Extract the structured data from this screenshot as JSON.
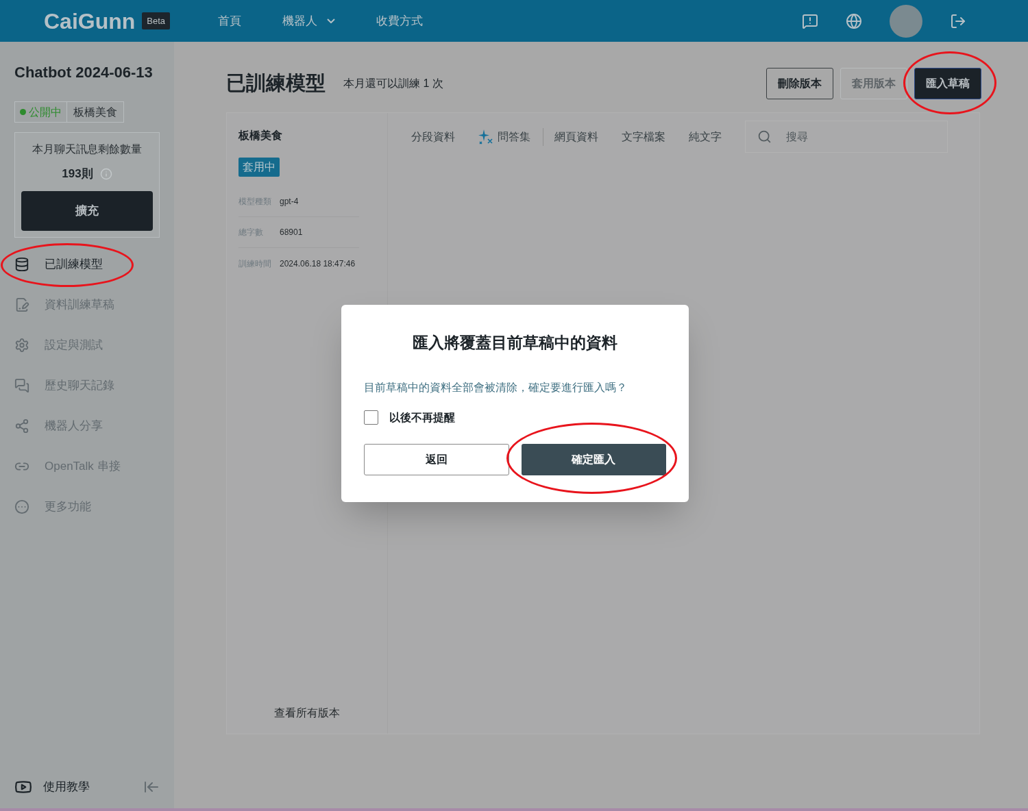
{
  "header": {
    "logo": "CaiGunn",
    "badge": "Beta",
    "nav": [
      {
        "label": "首頁",
        "dropdown": false
      },
      {
        "label": "機器人",
        "dropdown": true
      },
      {
        "label": "收費方式",
        "dropdown": false
      }
    ]
  },
  "sidebar": {
    "bot_name": "Chatbot 2024-06-13",
    "status": {
      "label": "公開中",
      "color": "#2e8b2e"
    },
    "tag": "板橋美食",
    "quota": {
      "title": "本月聊天訊息剩餘數量",
      "count": "193則",
      "button": "擴充"
    },
    "items": [
      {
        "label": "已訓練模型",
        "selected": true,
        "annotated": true
      },
      {
        "label": "資料訓練草稿",
        "selected": false,
        "annotated": false
      },
      {
        "label": "設定與測試",
        "selected": false,
        "annotated": false
      },
      {
        "label": "歷史聊天記錄",
        "selected": false,
        "annotated": false
      },
      {
        "label": "機器人分享",
        "selected": false,
        "annotated": false
      },
      {
        "label": "OpenTalk 串接",
        "selected": false,
        "annotated": false
      },
      {
        "label": "更多功能",
        "selected": false,
        "annotated": false
      }
    ],
    "tutorial": "使用教學"
  },
  "page": {
    "title": "已訓練模型",
    "subtitle": "本月還可以訓練 1 次",
    "actions": [
      {
        "label": "刪除版本",
        "kind": "outline",
        "annotated": false
      },
      {
        "label": "套用版本",
        "kind": "disabled",
        "annotated": false
      },
      {
        "label": "匯入草稿",
        "kind": "primary",
        "annotated": true
      }
    ]
  },
  "version": {
    "name": "板橋美食",
    "badge": "套用中",
    "fields": [
      {
        "label": "模型種類",
        "value": "gpt-4"
      },
      {
        "label": "總字數",
        "value": "68901"
      },
      {
        "label": "訓練時間",
        "value": "2024.06.18 18:47:46"
      }
    ],
    "all_versions": "查看所有版本"
  },
  "tabs": [
    {
      "label": "分段資料",
      "selected": false,
      "sparkle": false,
      "divider_after": false
    },
    {
      "label": "問答集",
      "selected": false,
      "sparkle": true,
      "divider_after": true
    },
    {
      "label": "網頁資料",
      "selected": false,
      "sparkle": false,
      "divider_after": false
    },
    {
      "label": "文字檔案",
      "selected": false,
      "sparkle": false,
      "divider_after": false
    },
    {
      "label": "純文字",
      "selected": false,
      "sparkle": false,
      "divider_after": false
    }
  ],
  "search": {
    "placeholder": "搜尋"
  },
  "dialog": {
    "title": "匯入將覆蓋目前草稿中的資料",
    "message": "目前草稿中的資料全部會被清除，確定要進行匯入嗎？",
    "checkbox": {
      "label": "以後不再提醒",
      "checked": false
    },
    "buttons": [
      {
        "label": "返回",
        "kind": "secondary",
        "annotated": false
      },
      {
        "label": "確定匯入",
        "kind": "primary",
        "annotated": true
      }
    ]
  }
}
